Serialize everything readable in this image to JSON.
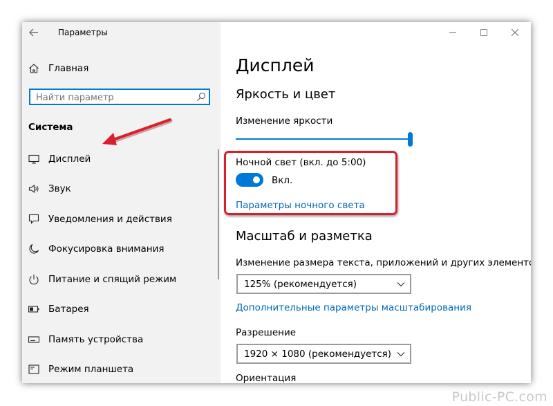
{
  "window": {
    "title": "Параметры"
  },
  "sidebar": {
    "home_label": "Главная",
    "search_placeholder": "Найти параметр",
    "section_title": "Система",
    "items": [
      {
        "label": "Дисплей",
        "icon": "display-icon"
      },
      {
        "label": "Звук",
        "icon": "speaker-icon"
      },
      {
        "label": "Уведомления и действия",
        "icon": "notification-icon"
      },
      {
        "label": "Фокусировка внимания",
        "icon": "moon-icon"
      },
      {
        "label": "Питание и спящий режим",
        "icon": "power-icon"
      },
      {
        "label": "Батарея",
        "icon": "battery-icon"
      },
      {
        "label": "Память устройства",
        "icon": "storage-icon"
      },
      {
        "label": "Режим планшета",
        "icon": "tablet-icon"
      }
    ]
  },
  "main": {
    "page_title": "Дисплей",
    "brightness_section": {
      "heading": "Яркость и цвет",
      "brightness_label": "Изменение яркости",
      "brightness_value": 1.0,
      "night_light_label": "Ночной свет (вкл. до 5:00)",
      "night_light_on": true,
      "toggle_state_label": "Вкл.",
      "night_light_settings_link": "Параметры ночного света"
    },
    "scale_section": {
      "heading": "Масштаб и разметка",
      "scale_label": "Изменение размера текста, приложений и других элементов",
      "scale_value": "125% (рекомендуется)",
      "advanced_scaling_link": "Дополнительные параметры масштабирования",
      "resolution_label": "Разрешение",
      "resolution_value": "1920 × 1080 (рекомендуется)",
      "orientation_label": "Ориентация"
    }
  },
  "watermark": "Public-PC.com",
  "colors": {
    "accent": "#0078d7",
    "link": "#0067b8",
    "sidebar_bg": "#f2f2f2",
    "annotation_red": "#d8202a"
  }
}
